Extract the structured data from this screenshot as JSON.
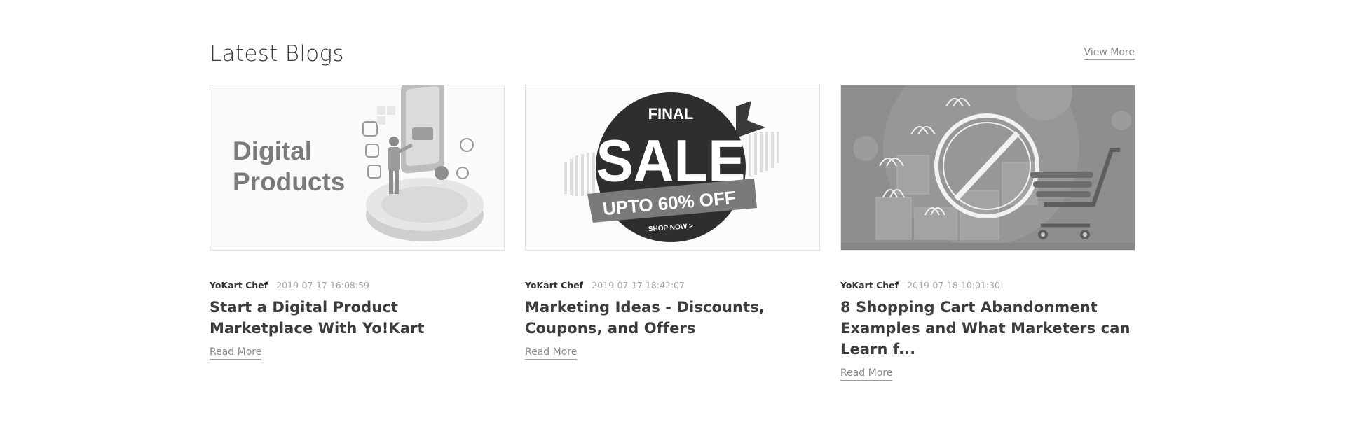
{
  "section": {
    "title": "Latest Blogs",
    "view_more_label": "View More"
  },
  "posts": [
    {
      "image_text_line1": "Digital",
      "image_text_line2": "Products",
      "author": "YoKart Chef",
      "date": "2019-07-17 16:08:59",
      "title": "Start a Digital Product Marketplace With Yo!Kart",
      "read_more_label": "Read More"
    },
    {
      "image_text_line1": "FINAL",
      "image_text_line2": "SALE",
      "image_text_line3": "UPTO 60% OFF",
      "image_text_line4": "SHOP NOW >",
      "author": "YoKart Chef",
      "date": "2019-07-17 18:42:07",
      "title": "Marketing Ideas - Discounts, Coupons, and Offers",
      "read_more_label": "Read More"
    },
    {
      "author": "YoKart Chef",
      "date": "2019-07-18 10:01:30",
      "title": "8 Shopping Cart Abandonment Examples and What Marketers can Learn f...",
      "read_more_label": "Read More"
    }
  ],
  "colors": {
    "title_text": "#3a3a3a",
    "meta_date": "#a5a5a5",
    "link_gray": "#8a8a8a",
    "image_border": "#e2e2e2"
  }
}
